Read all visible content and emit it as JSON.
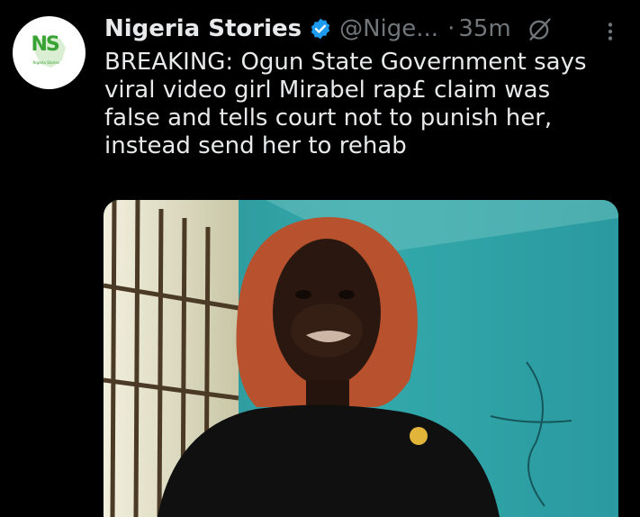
{
  "tweet": {
    "author_name": "Nigeria Stories",
    "handle": "@Nige...",
    "separator": "·",
    "time": "35m",
    "text": "BREAKING: Ogun State Government says\nviral video girl Mirabel rap£ claim was\nfalse and tells court not to punish her,\ninstead send her to rehab"
  },
  "avatar": {
    "logo_text": "NS",
    "logo_sub": "Nigeria Stories"
  },
  "icons": {
    "verified": "verified-badge-icon",
    "grok": "grok-icon",
    "more": "more-options-icon"
  },
  "colors": {
    "background": "#000000",
    "text": "#e7e9ea",
    "secondary": "#71767b",
    "verified": "#1d9bf0",
    "logo": "#3aa335"
  }
}
